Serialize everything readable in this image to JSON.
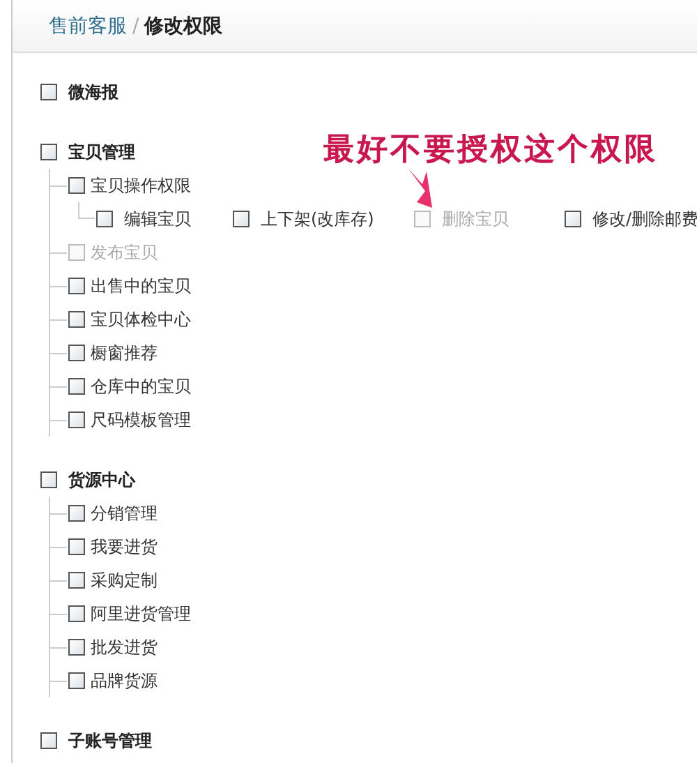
{
  "breadcrumb": {
    "parent": "售前客服",
    "separator": "/",
    "current": "修改权限"
  },
  "annotation": {
    "text": "最好不要授权这个权限"
  },
  "groups": [
    {
      "label": "微海报",
      "checked": false,
      "disabled": false
    },
    {
      "label": "宝贝管理",
      "checked": false,
      "disabled": false,
      "children": [
        {
          "label": "宝贝操作权限",
          "checked": false,
          "disabled": false,
          "children": [
            {
              "label": "编辑宝贝",
              "checked": false,
              "disabled": false
            },
            {
              "label": "上下架(改库存)",
              "checked": false,
              "disabled": false
            },
            {
              "label": "删除宝贝",
              "checked": false,
              "disabled": true
            },
            {
              "label": "修改/删除邮费",
              "checked": false,
              "disabled": false
            }
          ]
        },
        {
          "label": "发布宝贝",
          "checked": false,
          "disabled": true
        },
        {
          "label": "出售中的宝贝",
          "checked": false,
          "disabled": false
        },
        {
          "label": "宝贝体检中心",
          "checked": false,
          "disabled": false
        },
        {
          "label": "橱窗推荐",
          "checked": false,
          "disabled": false
        },
        {
          "label": "仓库中的宝贝",
          "checked": false,
          "disabled": false
        },
        {
          "label": "尺码模板管理",
          "checked": false,
          "disabled": false
        }
      ]
    },
    {
      "label": "货源中心",
      "checked": false,
      "disabled": false,
      "children": [
        {
          "label": "分销管理",
          "checked": false,
          "disabled": false
        },
        {
          "label": "我要进货",
          "checked": false,
          "disabled": false
        },
        {
          "label": "采购定制",
          "checked": false,
          "disabled": false
        },
        {
          "label": "阿里进货管理",
          "checked": false,
          "disabled": false
        },
        {
          "label": "批发进货",
          "checked": false,
          "disabled": false
        },
        {
          "label": "品牌货源",
          "checked": false,
          "disabled": false
        }
      ]
    },
    {
      "label": "子账号管理",
      "checked": false,
      "disabled": false
    }
  ]
}
